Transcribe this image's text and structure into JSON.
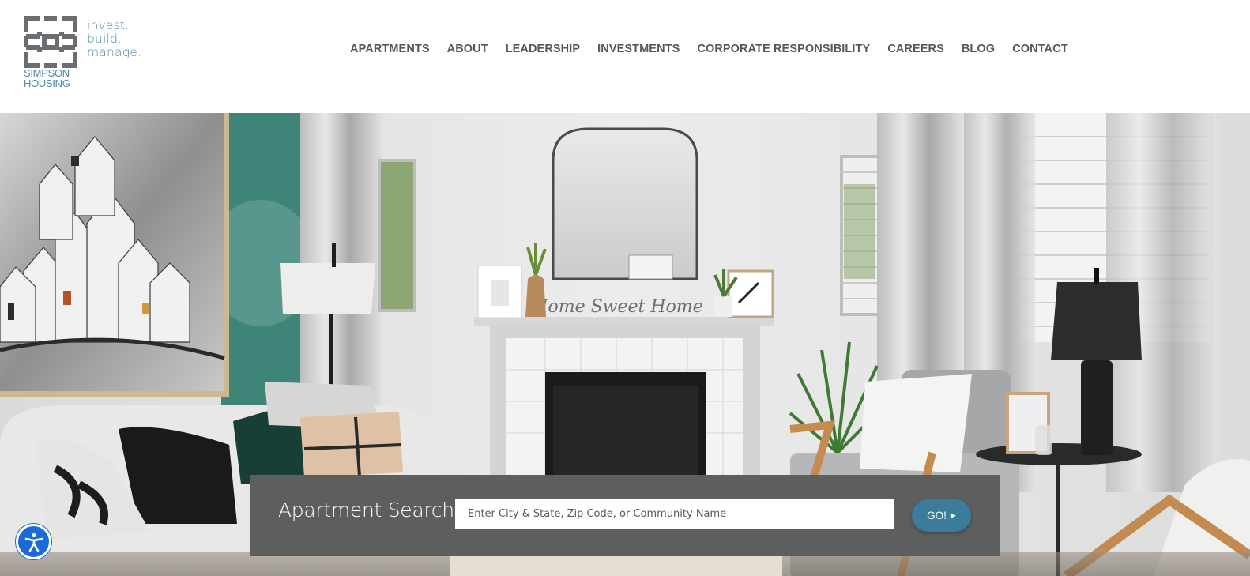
{
  "brand": {
    "tagline": [
      "invest.",
      "build.",
      "manage."
    ],
    "name_lines": [
      "SIMPSON",
      "HOUSING"
    ],
    "color": "#4d8aa6"
  },
  "nav": {
    "items": [
      "APARTMENTS",
      "ABOUT",
      "LEADERSHIP",
      "INVESTMENTS",
      "CORPORATE RESPONSIBILITY",
      "CAREERS",
      "BLOG",
      "CONTACT"
    ]
  },
  "hero": {
    "mantel_sign": "Home Sweet Home"
  },
  "search": {
    "title": "Apartment Search",
    "placeholder": "Enter City & State, Zip Code, or Community Name",
    "value": "",
    "button_label": "GO!",
    "button_color": "#3a7c99",
    "panel_color": "#5d5f5e"
  },
  "accessibility": {
    "icon": "accessibility-person-icon",
    "color": "#1a6ad9"
  }
}
